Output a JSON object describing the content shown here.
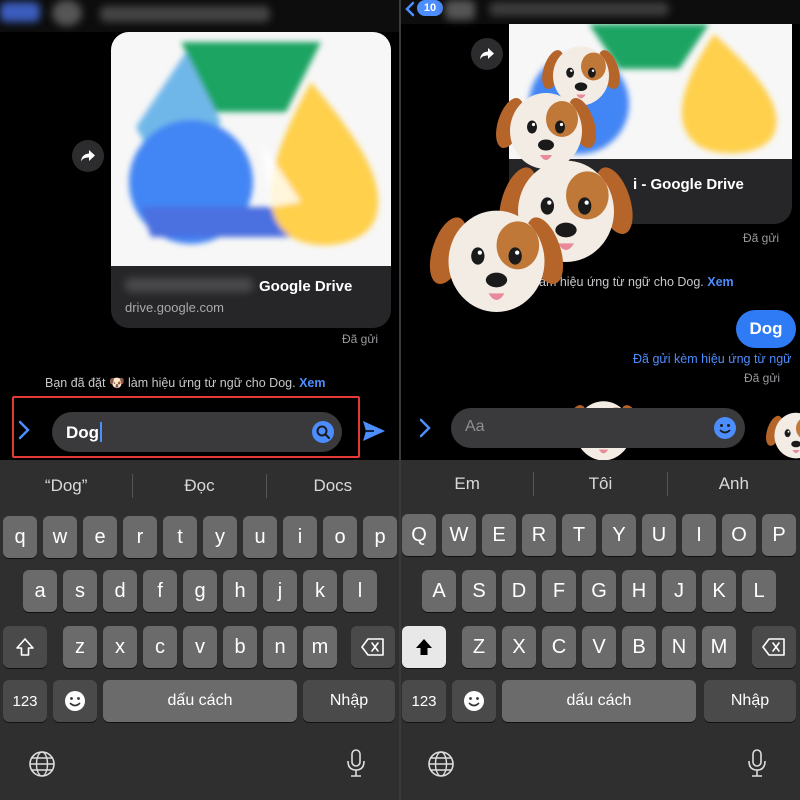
{
  "left": {
    "link_card": {
      "title": "Google Drive",
      "domain": "drive.google.com",
      "status": "Đã gửi"
    },
    "system_message": {
      "prefix": "Bạn đã đặt",
      "emoji": "🐶",
      "suffix": "làm hiệu ứng từ ngữ cho Dog.",
      "link": "Xem"
    },
    "composer": {
      "text": "Dog"
    },
    "suggestions": [
      "“Dog”",
      "Đọc",
      "Docs"
    ],
    "keys_row1": [
      "q",
      "w",
      "e",
      "r",
      "t",
      "y",
      "u",
      "i",
      "o",
      "p"
    ],
    "keys_row2": [
      "a",
      "s",
      "d",
      "f",
      "g",
      "h",
      "j",
      "k",
      "l"
    ],
    "keys_row3": [
      "z",
      "x",
      "c",
      "v",
      "b",
      "n",
      "m"
    ],
    "numbers_key": "123",
    "space_key": "dấu cách",
    "return_key": "Nhập"
  },
  "right": {
    "back_badge": "10",
    "link_card": {
      "title": "i - Google Drive",
      "status": "Đã gửi"
    },
    "system_message": {
      "suffix": "ăm hiệu ứng từ ngữ cho Dog.",
      "link": "Xem"
    },
    "bubble": "Dog",
    "effect_note": "Đã gửi kèm hiệu ứng từ ngữ",
    "status2": "Đã gửi",
    "composer": {
      "placeholder": "Aa"
    },
    "suggestions": [
      "Em",
      "Tôi",
      "Anh"
    ],
    "keys_row1": [
      "Q",
      "W",
      "E",
      "R",
      "T",
      "Y",
      "U",
      "I",
      "O",
      "P"
    ],
    "keys_row2": [
      "A",
      "S",
      "D",
      "F",
      "G",
      "H",
      "J",
      "K",
      "L"
    ],
    "keys_row3": [
      "Z",
      "X",
      "C",
      "V",
      "B",
      "N",
      "M"
    ],
    "numbers_key": "123",
    "space_key": "dấu cách",
    "return_key": "Nhập"
  },
  "colors": {
    "accent": "#4c8dff",
    "highlight": "#e53935",
    "drive_green": "#1fa463",
    "drive_blue": "#4285f4",
    "drive_yellow": "#ffd04b"
  },
  "icons": [
    "forward-icon",
    "chevron-right-icon",
    "search-icon",
    "send-icon",
    "shift-icon",
    "backspace-icon",
    "emoji-icon",
    "globe-icon",
    "mic-icon",
    "smiley-icon",
    "back-chevron-icon"
  ]
}
